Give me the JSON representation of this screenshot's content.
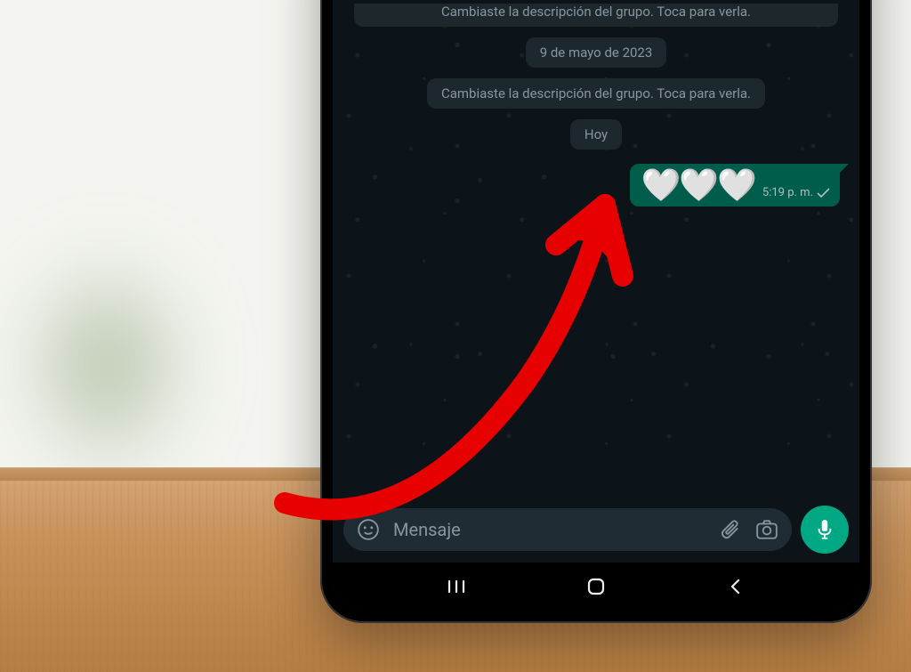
{
  "system_chips": {
    "top_truncated": "Cambiaste la descripción del grupo. Toca para verla.",
    "date": "9 de mayo de 2023",
    "description_changed": "Cambiaste la descripción del grupo. Toca para verla.",
    "today": "Hoy"
  },
  "message": {
    "content": "🤍🤍🤍",
    "time": "5:19 p. m.",
    "status": "sent"
  },
  "input": {
    "placeholder": "Mensaje"
  },
  "colors": {
    "bubble": "#005c4b",
    "mic": "#00a884",
    "chip": "#1d282e",
    "input_bg": "#1f2c34"
  }
}
